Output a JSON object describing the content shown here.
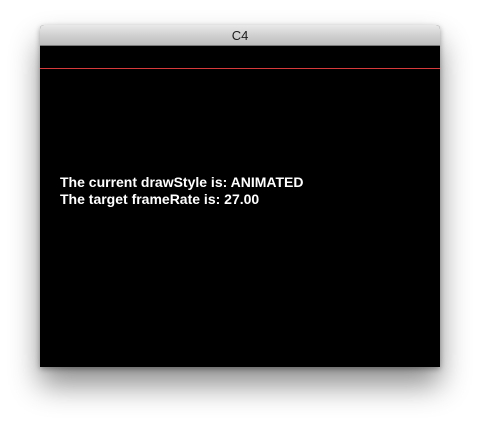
{
  "window": {
    "title": "C4"
  },
  "canvas": {
    "background_color": "#000000",
    "line_color": "#d63a3a",
    "draw_style_text": "The current drawStyle is: ANIMATED",
    "frame_rate_text": "The target frameRate is: 27.00"
  }
}
